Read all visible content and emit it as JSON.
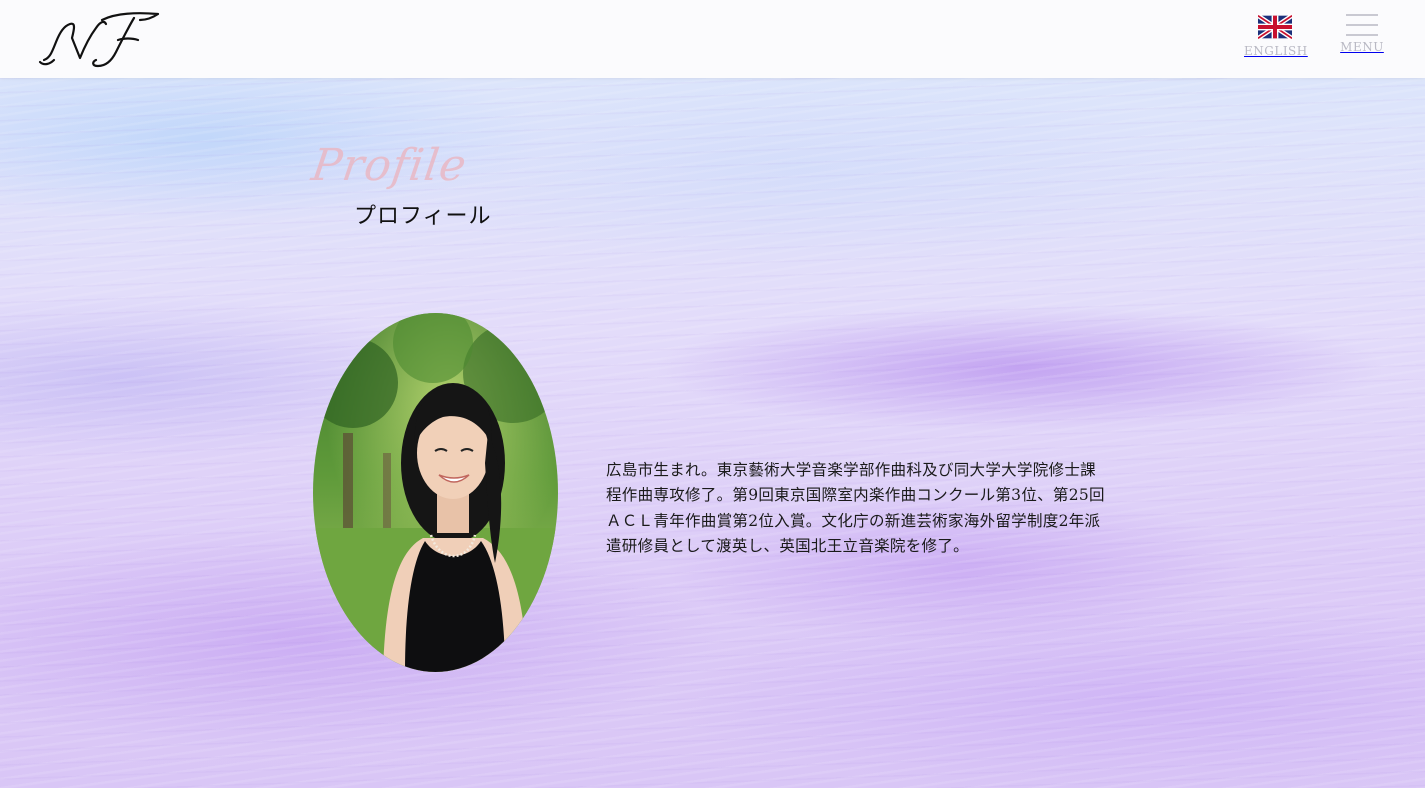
{
  "header": {
    "logo_text": "NF",
    "language_label": "ENGLISH",
    "language_icon": "uk-flag-icon",
    "menu_label": "MENU",
    "menu_icon": "hamburger-icon"
  },
  "profile": {
    "title_script": "Profile",
    "title_jp": "プロフィール",
    "bio": "広島市生まれ。東京藝術大学音楽学部作曲科及び同大学大学院修士課程作曲専攻修了。第9回東京国際室内楽作曲コンクール第3位、第25回ＡＣＬ青年作曲賞第2位入賞。文化庁の新進芸術家海外留学制度2年派遣研修員として渡英し、英国北王立音楽院を修了。"
  },
  "colors": {
    "script_title": "#e9b8c4",
    "header_bg": "#fbfbfd",
    "header_text": "#b9b9c4",
    "paint_purple": "#b98ef0",
    "paint_blue": "#aecdfa"
  }
}
